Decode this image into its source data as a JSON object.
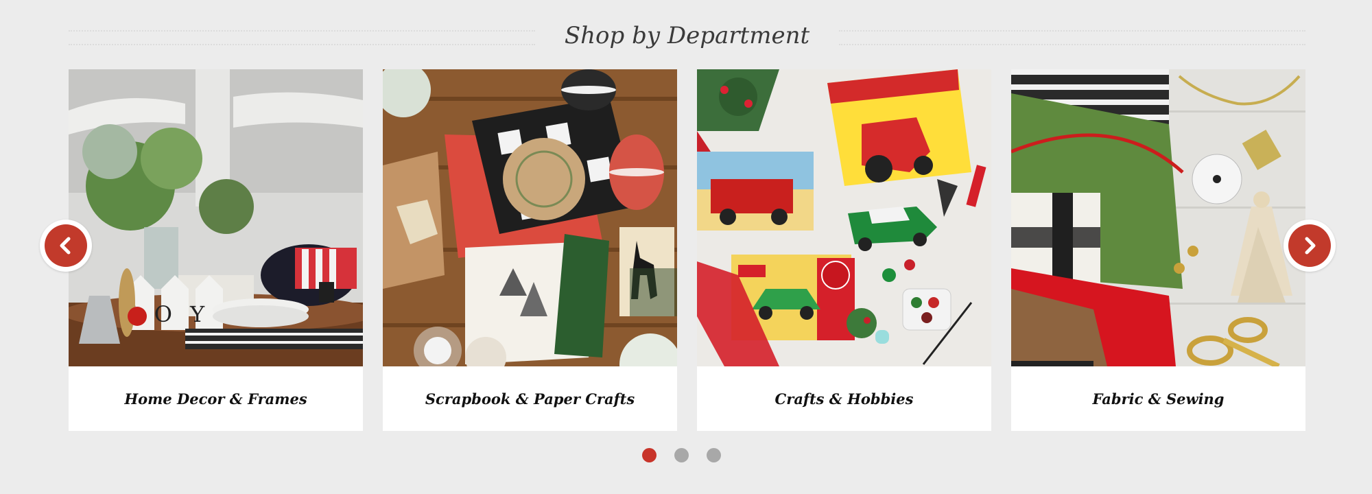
{
  "section": {
    "title": "Shop by Department"
  },
  "departments": [
    {
      "label": "Home Decor & Frames",
      "image_alt": "Home decor table with JOY blocks, greenery and plates"
    },
    {
      "label": "Scrapbook & Paper Crafts",
      "image_alt": "Paper crafts with buffalo plaid card, twine and reindeer stamp"
    },
    {
      "label": "Crafts & Hobbies",
      "image_alt": "Model kits with red tractor and Coca-Cola car boxes"
    },
    {
      "label": "Fabric & Sewing",
      "image_alt": "Fabrics, plaid, red velvet, ribbon, tassel and gold scissors"
    }
  ],
  "blocks_text": "JOY",
  "carousel": {
    "prev_icon": "chevron-left-icon",
    "next_icon": "chevron-right-icon",
    "active_page": 1,
    "page_count": 3
  },
  "colors": {
    "accent": "#c23a2b",
    "background": "#ececec",
    "dot_inactive": "#a8a8a8"
  }
}
